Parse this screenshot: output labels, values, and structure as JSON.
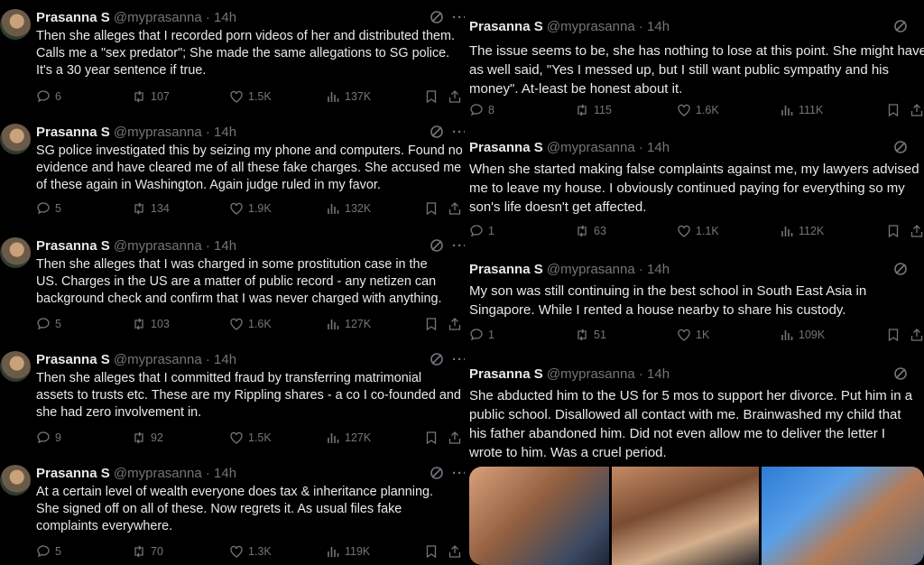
{
  "left_tweets": [
    {
      "name": "Prasanna S",
      "handle": "@myprasanna",
      "time": "14h",
      "text": "Then she alleges that I recorded porn videos of her and distributed them. Calls me a \"sex predator\"; She made the same allegations to SG police. It's a 30 year sentence if true.",
      "replies": "6",
      "reposts": "107",
      "likes": "1.5K",
      "views": "137K"
    },
    {
      "name": "Prasanna S",
      "handle": "@myprasanna",
      "time": "14h",
      "text": "SG police investigated this by seizing my phone and computers. Found no evidence and have cleared me of all these fake charges. She accused me of these again in Washington. Again judge ruled in my favor.",
      "replies": "5",
      "reposts": "134",
      "likes": "1.9K",
      "views": "132K"
    },
    {
      "name": "Prasanna S",
      "handle": "@myprasanna",
      "time": "14h",
      "text": "Then she alleges that I was charged in some prostitution case in the US. Charges in the US are a matter of public record - any netizen can background check and confirm that I was never charged with anything.",
      "replies": "5",
      "reposts": "103",
      "likes": "1.6K",
      "views": "127K"
    },
    {
      "name": "Prasanna S",
      "handle": "@myprasanna",
      "time": "14h",
      "text": "Then she alleges that I committed fraud by transferring matrimonial assets to trusts etc. These are my Rippling shares - a co I co-founded and she had zero involvement in.",
      "replies": "9",
      "reposts": "92",
      "likes": "1.5K",
      "views": "127K"
    },
    {
      "name": "Prasanna S",
      "handle": "@myprasanna",
      "time": "14h",
      "text": "At a certain level of wealth everyone does tax & inheritance planning. She signed off on all of these. Now regrets it. As usual files fake complaints everywhere.",
      "replies": "5",
      "reposts": "70",
      "likes": "1.3K",
      "views": "119K"
    }
  ],
  "right_tweets": [
    {
      "name": "Prasanna S",
      "handle": "@myprasanna",
      "time": "14h",
      "text": "The issue seems to be, she has nothing to lose at this point. She might have as well said, \"Yes I messed up, but I still want public sympathy and his money\". At-least be honest about it.",
      "replies": "8",
      "reposts": "115",
      "likes": "1.6K",
      "views": "111K"
    },
    {
      "name": "Prasanna S",
      "handle": "@myprasanna",
      "time": "14h",
      "text": "When she started making false complaints against me, my lawyers advised me to leave my house. I obviously continued paying for everything so my son's life doesn't get affected.",
      "replies": "1",
      "reposts": "63",
      "likes": "1.1K",
      "views": "112K"
    },
    {
      "name": "Prasanna S",
      "handle": "@myprasanna",
      "time": "14h",
      "text": "My son was still continuing in the best school in South East Asia in Singapore. While I rented a house nearby to share his custody.",
      "replies": "1",
      "reposts": "51",
      "likes": "1K",
      "views": "109K"
    },
    {
      "name": "Prasanna S",
      "handle": "@myprasanna",
      "time": "14h",
      "text": "She abducted him to the US for 5 mos to support her divorce. Put him in a public school. Disallowed all contact with me. Brainwashed my child that his father abandoned him. Did not even allow me to deliver the letter I wrote to him. Was a cruel period."
    }
  ]
}
